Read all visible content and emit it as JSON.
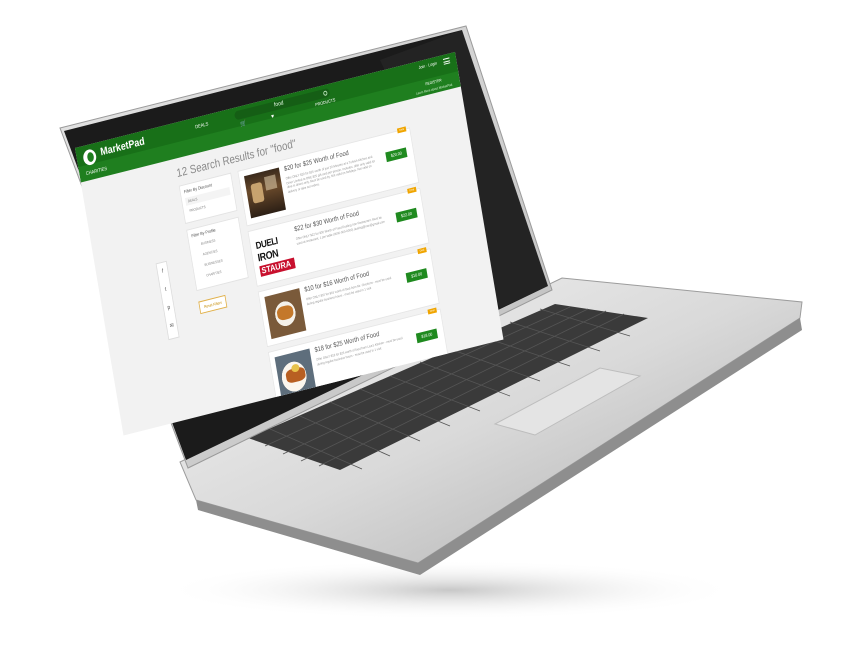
{
  "header": {
    "brand": "MarketPad",
    "nav_deals": "DEALS",
    "nav_products": "PRODUCTS",
    "nav_charities": "CHARITIES",
    "search_value": "food",
    "user_link_1": "Join",
    "user_link_2": "Login",
    "register_link": "REGISTER",
    "sub_link": "Learn More about MarketPad",
    "icons": [
      "cart-icon",
      "heart-icon",
      "menu-icon",
      "search-icon"
    ]
  },
  "share_rail": {
    "icons": [
      "facebook-icon",
      "twitter-icon",
      "pinterest-icon",
      "email-icon",
      "plus-icon"
    ],
    "glyphs": [
      "f",
      "t",
      "p",
      "✉",
      "+"
    ]
  },
  "results": {
    "title": "12 Search Results for \"food\""
  },
  "sidebar": {
    "discount_heading": "Filter By Discount",
    "discount_options": [
      "DEALS",
      "PRODUCTS"
    ],
    "profile_heading": "Filter By Profile",
    "profile_options": [
      "BUSINESS",
      "AGENCIES",
      "BUSINESSES",
      "CHARITIES"
    ],
    "reset_label": "Reset Filters"
  },
  "deals": [
    {
      "title": "$20 for $25 Worth of Food",
      "description": "Offer ONLY $20 for $25 worth of just 20 Minutes at a Turkish Kitchen and Diner Limited to ONE $25 gift card per person. Includes: offer only valid for dine-in diners only, Must be used by. Not valid on holidays. Not valid on delivery or take out orders.",
      "price": "$20.00",
      "tag": "Deal"
    },
    {
      "title": "$22 for $30 Worth of Food",
      "description": "Offer ONLY $22 for $30 Worth of Food Dueling Iron Restaurant. Must be used at restaurant, 1 per table (0000-000-0000) dueling@iron@gmail.com",
      "price": "$22.00",
      "tag": "Deal"
    },
    {
      "title": "$10 for $16 Worth of Food",
      "description": "Offer ONLY $10 for $16 worth of food from Mr. Chickens - must be used during regular business hours - must be used in 1 visit",
      "price": "$10.00",
      "tag": "Deal"
    },
    {
      "title": "$18 for $25 Worth of Food",
      "description": "Offer ONLY $18 for $25 worth of food from Lisa's Kitchen - must be used during regular business hours - must be used in 1 visit",
      "price": "$18.00",
      "tag": "Deal"
    }
  ],
  "colors": {
    "brand_green": "#1f7f1f",
    "price_green": "#1f8a1f",
    "tag_orange": "#f0a500"
  }
}
